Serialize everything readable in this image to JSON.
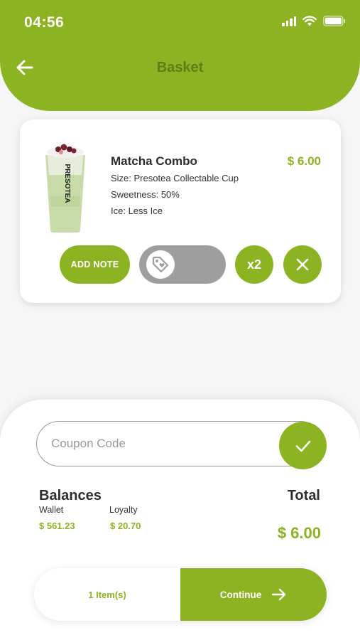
{
  "status_bar": {
    "time": "04:56"
  },
  "header": {
    "title": "Basket"
  },
  "item": {
    "name": "Matcha Combo",
    "price": "$ 6.00",
    "size": "Size: Presotea Collectable Cup",
    "sweetness": "Sweetness: 50%",
    "ice": "Ice: Less Ice",
    "image_brand": "PRESOTEA",
    "add_note_label": "ADD NOTE",
    "quantity_label": "x2"
  },
  "coupon": {
    "placeholder": "Coupon Code"
  },
  "balances": {
    "title": "Balances",
    "wallet_label": "Wallet",
    "wallet_value": "$ 561.23",
    "loyalty_label": "Loyalty",
    "loyalty_value": "$ 20.70"
  },
  "total": {
    "label": "Total",
    "value": "$ 6.00"
  },
  "checkout": {
    "items_label": "1 Item(s)",
    "continue_label": "Continue"
  },
  "colors": {
    "accent": "#8cb322",
    "header_title": "#5f7d15",
    "tag_toggle": "#9e9e9e"
  },
  "icons": [
    "back-arrow-icon",
    "signal-icon",
    "wifi-icon",
    "battery-icon",
    "tag-icon",
    "close-icon",
    "check-icon",
    "arrow-right-icon"
  ]
}
